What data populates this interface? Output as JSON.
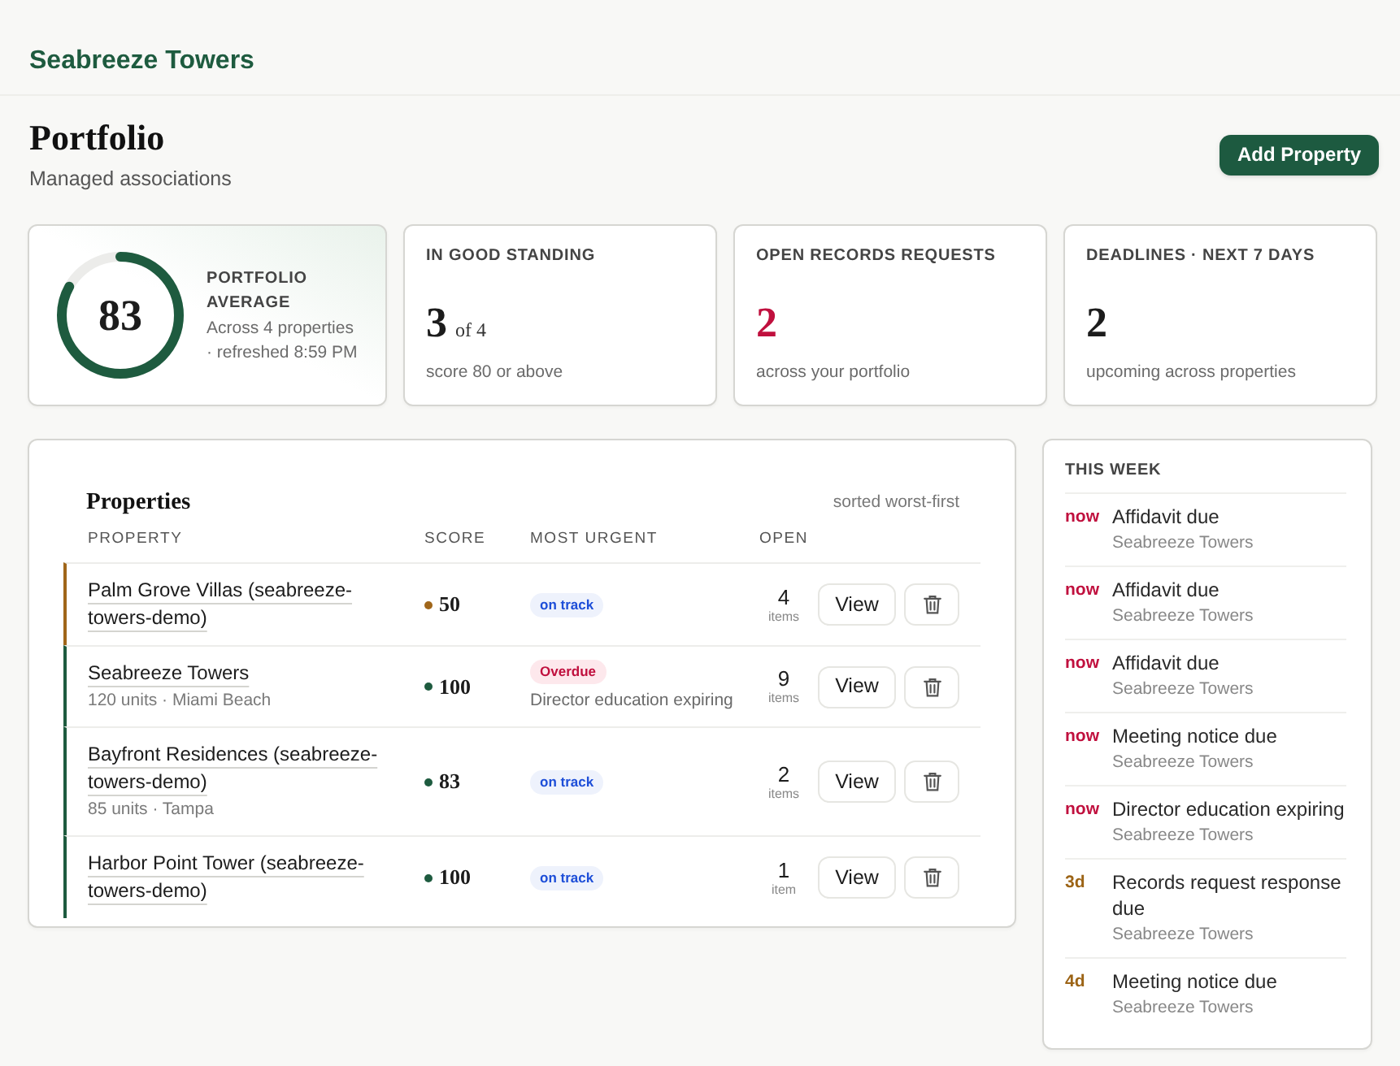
{
  "app": {
    "brand": "Seabreeze Towers"
  },
  "page": {
    "title": "Portfolio",
    "subtitle": "Managed associations",
    "action": "Add Property"
  },
  "stats": [
    {
      "kind": "ring",
      "label": "PORTFOLIO AVERAGE",
      "value": "83",
      "level": 0.83,
      "alert": false,
      "note": "Across 4 properties · refreshed 8:59 PM"
    },
    {
      "kind": "number",
      "label": "IN GOOD STANDING",
      "value": "3",
      "suffix": "of 4",
      "alert": false,
      "note": "score 80 or above"
    },
    {
      "kind": "number",
      "label": "OPEN RECORDS REQUESTS",
      "value": "2",
      "alert": true,
      "note": "across your portfolio"
    },
    {
      "kind": "number",
      "label": "DEADLINES · NEXT 7 DAYS",
      "value": "2",
      "alert": false,
      "note": "upcoming across properties"
    }
  ],
  "properties": {
    "title": "Properties",
    "sort_note": "sorted worst-first",
    "columns": [
      "PROPERTY",
      "SCORE",
      "MOST URGENT",
      "OPEN"
    ],
    "rows": [
      {
        "name": "Palm Grove Villas (seabreeze-towers-demo)",
        "score": "50",
        "color": "#a0661a",
        "urgent": {
          "kind": "ok",
          "label": "on track"
        },
        "open": "4",
        "open_unit": "items",
        "view": "View"
      },
      {
        "name": "Seabreeze Towers",
        "detail": "120 units · Miami Beach",
        "score": "100",
        "color": "#1e5b3f",
        "urgent": {
          "kind": "overdue",
          "label": "Overdue",
          "detail": "Director education expiring"
        },
        "open": "9",
        "open_unit": "items",
        "view": "View"
      },
      {
        "name": "Bayfront Residences (seabreeze-towers-demo)",
        "detail": "85 units · Tampa",
        "score": "83",
        "color": "#1e5b3f",
        "urgent": {
          "kind": "ok",
          "label": "on track"
        },
        "open": "2",
        "open_unit": "items",
        "view": "View"
      },
      {
        "name": "Harbor Point Tower (seabreeze-towers-demo)",
        "score": "100",
        "color": "#1e5b3f",
        "urgent": {
          "kind": "ok",
          "label": "on track"
        },
        "open": "1",
        "open_unit": "item",
        "view": "View"
      }
    ]
  },
  "week": {
    "title": "THIS WEEK",
    "items": [
      {
        "when": "now",
        "color": "#c0103e",
        "title": "Affidavit due",
        "property": "Seabreeze Towers"
      },
      {
        "when": "now",
        "color": "#c0103e",
        "title": "Affidavit due",
        "property": "Seabreeze Towers"
      },
      {
        "when": "now",
        "color": "#c0103e",
        "title": "Affidavit due",
        "property": "Seabreeze Towers"
      },
      {
        "when": "now",
        "color": "#c0103e",
        "title": "Meeting notice due",
        "property": "Seabreeze Towers"
      },
      {
        "when": "now",
        "color": "#c0103e",
        "title": "Director education expiring",
        "property": "Seabreeze Towers"
      },
      {
        "when": "3d",
        "color": "#9c6416",
        "title": "Records request response due",
        "property": "Seabreeze Towers"
      },
      {
        "when": "4d",
        "color": "#9c6416",
        "title": "Meeting notice due",
        "property": "Seabreeze Towers"
      }
    ]
  }
}
